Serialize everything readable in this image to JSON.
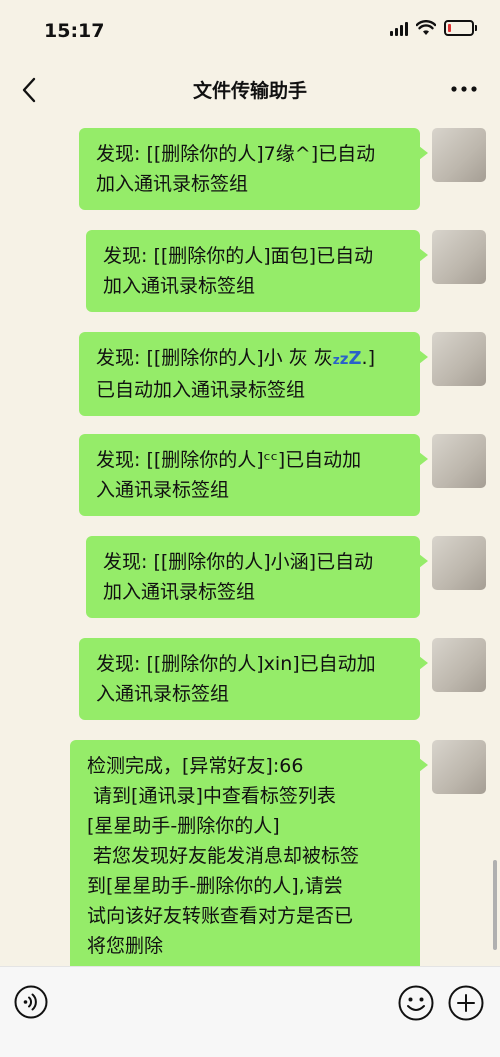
{
  "status": {
    "time": "15:17",
    "battery_level": 0.15
  },
  "header": {
    "title": "文件传输助手"
  },
  "messages": [
    {
      "text": "发现: [[删除你的人]7缘^]已自动\n加入通讯录标签组"
    },
    {
      "text": "发现: [[删除你的人]面包]已自动\n加入通讯录标签组"
    },
    {
      "text_before": "发现: [[删除你的人]小 灰 灰",
      "zzz": [
        "z",
        "z",
        "Z"
      ],
      "text_after": ".]\n已自动加入通讯录标签组"
    },
    {
      "text": "发现: [[删除你的人]ᶜᶜ]已自动加\n入通讯录标签组"
    },
    {
      "text": "发现: [[删除你的人]小涵]已自动\n加入通讯录标签组"
    },
    {
      "text": "发现: [[删除你的人]xin]已自动加\n入通讯录标签组"
    },
    {
      "text": "检测完成，[异常好友]:66\n 请到[通讯录]中查看标签列表\n[星星助手-删除你的人]\n 若您发现好友能发消息却被标签\n到[星星助手-删除你的人],请尝\n试向该好友转账查看对方是否已\n将您删除"
    }
  ],
  "colors": {
    "bubble": "#95ec69",
    "background": "#f6f2e6",
    "zzz": "#2a62c9"
  },
  "icons": {
    "back": "chevron-left-icon",
    "more": "more-dots-icon",
    "voice": "voice-icon",
    "emoji": "emoji-icon",
    "plus": "plus-icon"
  }
}
